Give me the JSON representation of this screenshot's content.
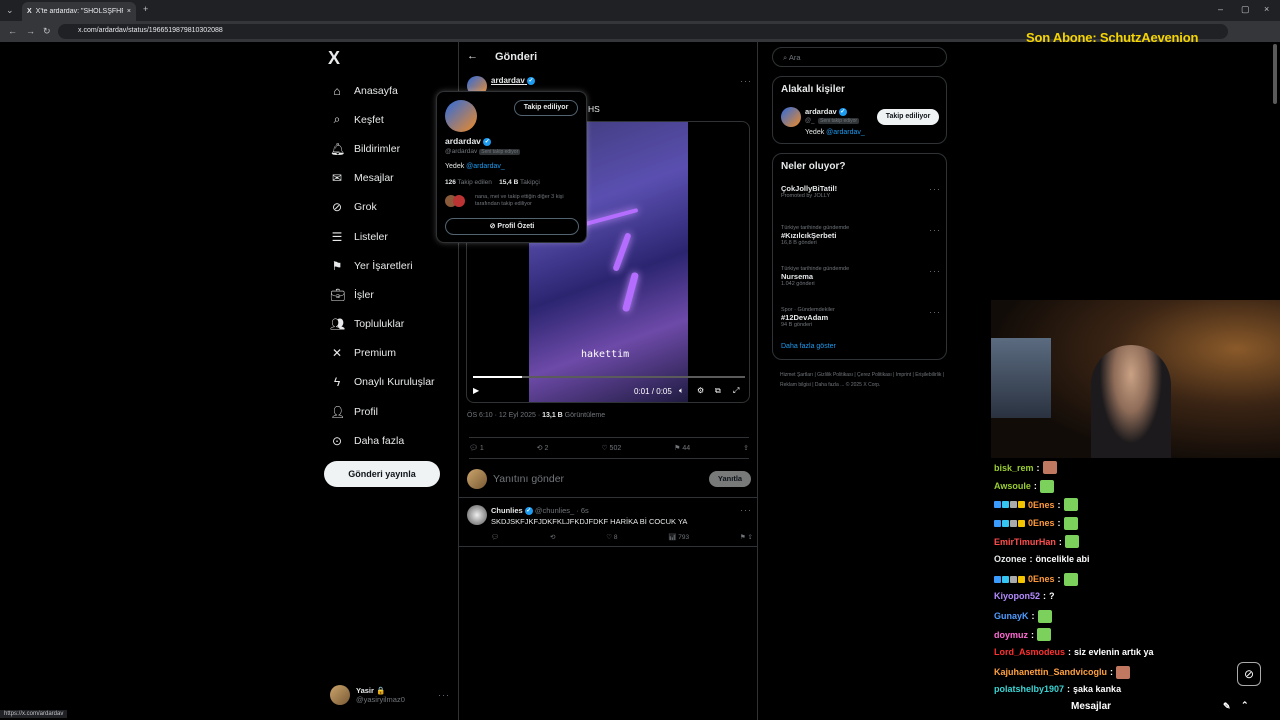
{
  "browser": {
    "tab_title": "X'te ardardav: \"SHÖLSŞFHFSM\" ...",
    "url": "x.com/ardardav/status/1966519879810302088",
    "status_url": "https://x.com/ardardav",
    "new_tab": "+",
    "close_tab": "×",
    "window_controls": [
      "–",
      "▢",
      "×"
    ],
    "nav_buttons": [
      "←",
      "→",
      "↻"
    ]
  },
  "overlay": {
    "title": "Son Abone: SchutzAevenion"
  },
  "sidebar": {
    "logo": "X",
    "items": [
      {
        "label": "Anasayfa",
        "icon": "home-icon",
        "glyph": "⌂"
      },
      {
        "label": "Keşfet",
        "icon": "search-icon",
        "glyph": "⌕"
      },
      {
        "label": "Bildirimler",
        "icon": "bell-icon",
        "glyph": "🔔︎"
      },
      {
        "label": "Mesajlar",
        "icon": "mail-icon",
        "glyph": "✉"
      },
      {
        "label": "Grok",
        "icon": "grok-icon",
        "glyph": "⊘"
      },
      {
        "label": "Listeler",
        "icon": "list-icon",
        "glyph": "☰"
      },
      {
        "label": "Yer İşaretleri",
        "icon": "bookmark-icon",
        "glyph": "⚑"
      },
      {
        "label": "İşler",
        "icon": "briefcase-icon",
        "glyph": "💼︎"
      },
      {
        "label": "Topluluklar",
        "icon": "people-icon",
        "glyph": "👥︎"
      },
      {
        "label": "Premium",
        "icon": "x-premium-icon",
        "glyph": "✕"
      },
      {
        "label": "Onaylı Kuruluşlar",
        "icon": "lightning-icon",
        "glyph": "ϟ"
      },
      {
        "label": "Profil",
        "icon": "user-icon",
        "glyph": "👤︎"
      },
      {
        "label": "Daha fazla",
        "icon": "more-circle-icon",
        "glyph": "⊙"
      }
    ],
    "post_button": "Gönderi yayınla",
    "user": {
      "name": "Yasir 🔒",
      "handle": "@yasiryilmaz0"
    }
  },
  "main": {
    "header_title": "Gönderi",
    "post": {
      "author": "ardardav",
      "text_fragment": "HS",
      "video_caption": "hakettim",
      "progress": 0.18,
      "time": "0:01 / 0:05",
      "meta_time": "ÖS 6:10 · 12 Eyl 2025 · ",
      "views": "13,1 B",
      "views_label": " Görüntüleme",
      "replies": "1",
      "reposts": "2",
      "likes": "502",
      "bookmarks": "44"
    },
    "reply_placeholder": "Yanıtını gönder",
    "reply_button": "Yanıtla",
    "reply_card": {
      "name": "Chunlies",
      "handle": "@chunlies_ · 6s",
      "text": "SKDJSKFJKFJDKFKLJFKDJFDKF HARİKA Bİ COCUK YA",
      "reposts": "",
      "likes": "8",
      "views": "793"
    }
  },
  "hover_card": {
    "follow_button": "Takip ediliyor",
    "name": "ardardav",
    "handle": "@ardardav",
    "badge": "Seni takip ediyor",
    "bio_prefix": "Yedek ",
    "bio_link": "@ardardav_",
    "following_count": "126",
    "following_label": " Takip edilen",
    "followers_count": "15,4 B",
    "followers_label": " Takipçi",
    "mutual": "nana, mei ve takip ettiğin diğer 3 kişi tarafından takip ediliyor",
    "summary_button": "Profil Özeti"
  },
  "right": {
    "search_placeholder": "Ara",
    "related_title": "Alakalı kişiler",
    "related_person": {
      "name": "ardardav",
      "handle": "@_",
      "badge": "Seni takip ediyor",
      "bio_prefix": "Yedek ",
      "bio_link": "@ardardav_",
      "follow": "Takip ediliyor"
    },
    "trends_title": "Neler oluyor?",
    "trends": [
      {
        "category": "",
        "name": "ÇokJollyBiTatil!",
        "count": "Promoted by JOLLY"
      },
      {
        "category": "Türkiye tarihinde gündemde",
        "name": "#KızılcıkŞerbeti",
        "count": "16,8 B gönderi"
      },
      {
        "category": "Türkiye tarihinde gündemde",
        "name": "Nursema",
        "count": "1.042 gönderi"
      },
      {
        "category": "Spor · Gündemdekiler",
        "name": "#12DevAdam",
        "count": "94 B gönderi"
      }
    ],
    "more": "Daha fazla göster",
    "footer": "Hizmet Şartları | Gizlilik Politikası | Çerez Politikası | Imprint | Erişilebilirlik | Reklam bilgisi | Daha fazla ... © 2025 X Corp."
  },
  "chat": {
    "messages": [
      {
        "user": "bisk_rem",
        "color": "#9acd32",
        "text": "",
        "emote": "face",
        "badges": []
      },
      {
        "user": "Awsoule",
        "color": "#9acd32",
        "text": "",
        "emote": "green",
        "badges": []
      },
      {
        "user": "0Enes",
        "color": "#ff9a3c",
        "text": "",
        "emote": "green",
        "badges": [
          "#3a9cff",
          "#36c5f0",
          "#aaa",
          "#f5c400"
        ]
      },
      {
        "user": "0Enes",
        "color": "#ff9a3c",
        "text": "",
        "emote": "green",
        "badges": [
          "#3a9cff",
          "#36c5f0",
          "#aaa",
          "#f5c400"
        ]
      },
      {
        "user": "EmirTimurHan",
        "color": "#ff4d4d",
        "text": "",
        "emote": "green",
        "badges": []
      },
      {
        "user": "Ozonee",
        "color": "#e7e9ea",
        "text": "öncelikle abi",
        "emote": "",
        "badges": []
      },
      {
        "user": "0Enes",
        "color": "#ff9a3c",
        "text": "",
        "emote": "green",
        "badges": [
          "#3a9cff",
          "#36c5f0",
          "#aaa",
          "#f5c400"
        ]
      },
      {
        "user": "Kiyopon52",
        "color": "#b58cff",
        "text": "?",
        "emote": "",
        "badges": []
      },
      {
        "user": "GunayK",
        "color": "#4f9cff",
        "text": "",
        "emote": "green",
        "badges": []
      },
      {
        "user": "doymuz",
        "color": "#ff6ad5",
        "text": "",
        "emote": "green",
        "badges": []
      },
      {
        "user": "Lord_Asmodeus",
        "color": "#ff3030",
        "text": "siz evlenin artık ya",
        "emote": "",
        "badges": []
      },
      {
        "user": "Kajuhanettin_Sandvicoglu",
        "color": "#ffa040",
        "text": "",
        "emote": "face",
        "badges": []
      },
      {
        "user": "polatshelby1907",
        "color": "#3cd3d3",
        "text": "şaka kanka",
        "emote": "",
        "badges": []
      }
    ],
    "footer_label": "Mesajlar"
  }
}
